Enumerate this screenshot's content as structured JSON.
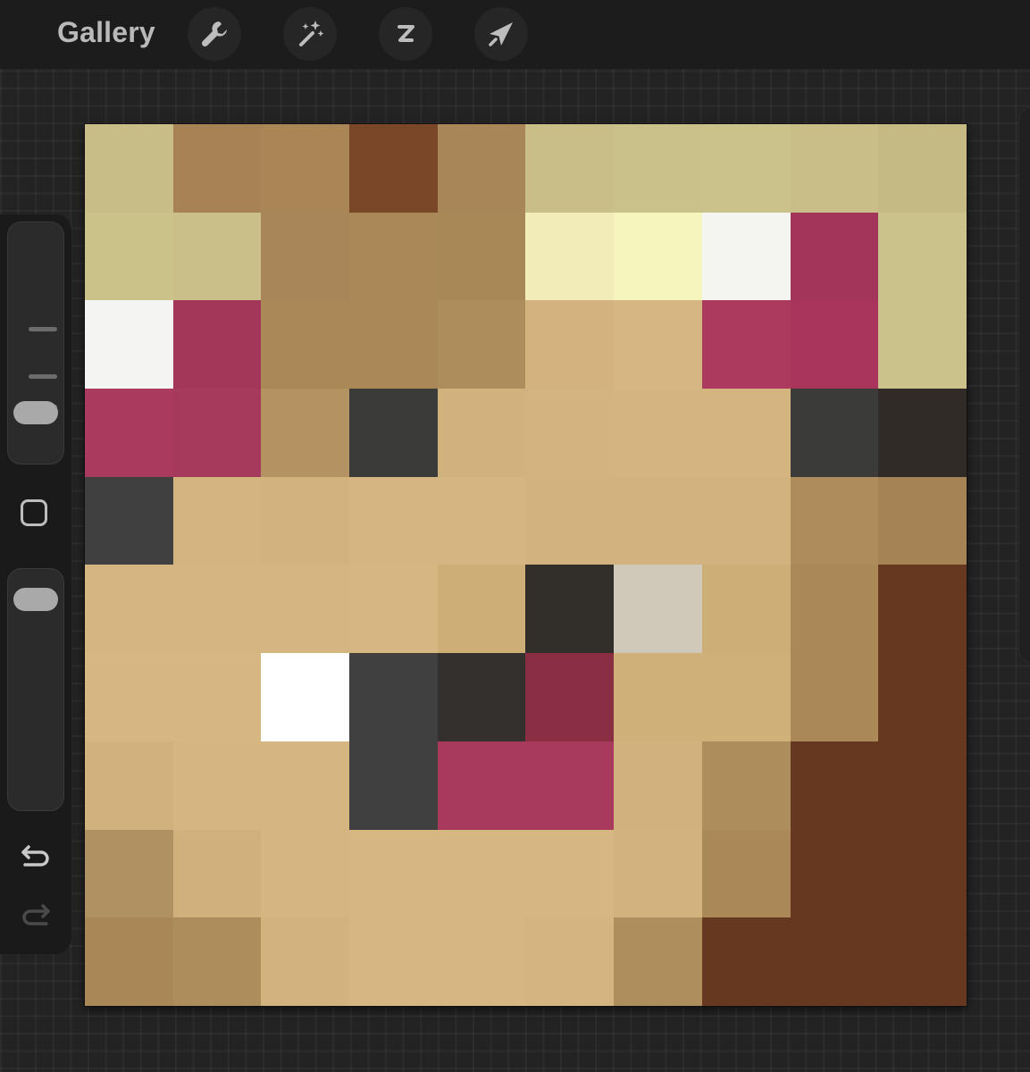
{
  "toolbar": {
    "gallery_label": "Gallery",
    "tools": [
      {
        "name": "actions",
        "icon": "wrench-icon"
      },
      {
        "name": "adjustments",
        "icon": "magic-wand-icon"
      },
      {
        "name": "selection",
        "icon": "selection-s-icon"
      },
      {
        "name": "transform",
        "icon": "arrow-cursor-icon"
      }
    ]
  },
  "sidebar": {
    "brush_size": 0.15,
    "brush_opacity": 0.95,
    "modify_icon": "square-icon",
    "undo_icon": "undo-arrow-icon",
    "redo_icon": "redo-arrow-icon",
    "redo_enabled": false
  },
  "canvas": {
    "grid_size": 10,
    "pixels": [
      [
        "#C8BC87",
        "#A78254",
        "#AA8657",
        "#7A4729",
        "#A98657",
        "#C9BE88",
        "#CAC18A",
        "#CAC28A",
        "#C9BE88",
        "#C6BA84"
      ],
      [
        "#CBC28A",
        "#CABF89",
        "#A8865A",
        "#AA8858",
        "#A98858",
        "#F2EDB8",
        "#F6F5BE",
        "#F4F4F0",
        "#A3355A",
        "#CAC28A"
      ],
      [
        "#F4F4F2",
        "#A3375A",
        "#AA8858",
        "#AA8858",
        "#AE8D5D",
        "#D4B27E",
        "#D6B782",
        "#AC3A5F",
        "#A9355D",
        "#CAC28A"
      ],
      [
        "#AA3A5E",
        "#A63A5D",
        "#B49262",
        "#3B3B3A",
        "#D2B27C",
        "#D4B47E",
        "#D4B47F",
        "#D4B47F",
        "#3B3C3A",
        "#312B27"
      ],
      [
        "#404040",
        "#D4B57F",
        "#D3B37D",
        "#D5B680",
        "#D5B680",
        "#D3B37D",
        "#D3B37D",
        "#D3B37D",
        "#AE8C5C",
        "#A68355"
      ],
      [
        "#D5B680",
        "#D5B680",
        "#D5B680",
        "#D6B781",
        "#CEAE77",
        "#322E2A",
        "#D0C9BA",
        "#CEAE77",
        "#AA8858",
        "#673820"
      ],
      [
        "#D6B781",
        "#D6B781",
        "#FFFFFF",
        "#404040",
        "#33302D",
        "#8A2E44",
        "#D0B079",
        "#D0B079",
        "#AA8858",
        "#673820"
      ],
      [
        "#D2B27C",
        "#D5B680",
        "#D5B680",
        "#404040",
        "#A83A5E",
        "#A83A5E",
        "#D2B27C",
        "#AE8D5D",
        "#673820",
        "#673820"
      ],
      [
        "#B09161",
        "#D1B17B",
        "#D5B680",
        "#D6B781",
        "#D6B781",
        "#D6B781",
        "#D3B37D",
        "#AA8858",
        "#673820",
        "#673820"
      ],
      [
        "#A98756",
        "#AE8D5D",
        "#D3B37D",
        "#D6B781",
        "#D6B781",
        "#D4B57F",
        "#AF8E5D",
        "#673820",
        "#673820",
        "#673820"
      ]
    ]
  }
}
